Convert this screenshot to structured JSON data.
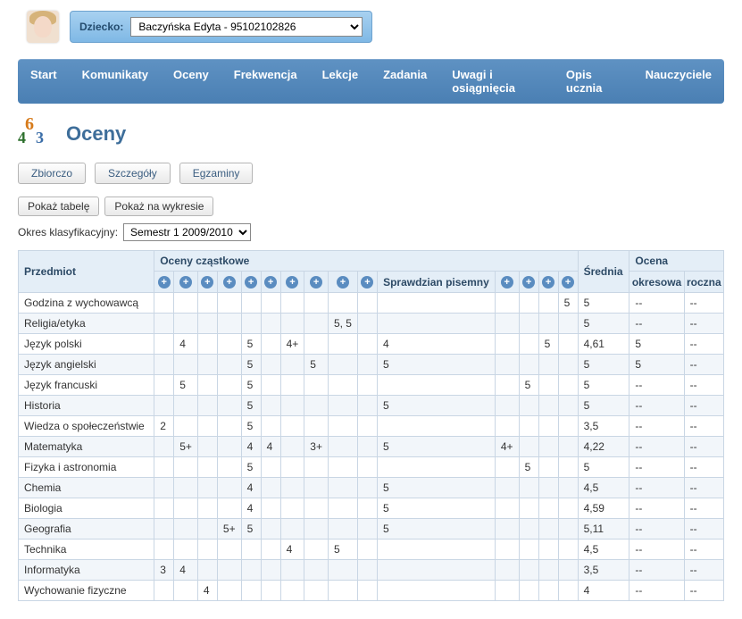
{
  "child_label": "Dziecko:",
  "child_selected": "Baczyńska Edyta - 95102102826",
  "nav": [
    "Start",
    "Komunikaty",
    "Oceny",
    "Frekwencja",
    "Lekcje",
    "Zadania",
    "Uwagi i osiągnięcia",
    "Opis ucznia",
    "Nauczyciele"
  ],
  "page_title": "Oceny",
  "tabs": [
    "Zbiorczo",
    "Szczegóły",
    "Egzaminy"
  ],
  "view_buttons": [
    "Pokaż tabelę",
    "Pokaż na wykresie"
  ],
  "period_label": "Okres klasyfikacyjny:",
  "period_selected": "Semestr 1 2009/2010",
  "headers": {
    "subject": "Przedmiot",
    "partial": "Oceny cząstkowe",
    "written": "Sprawdzian pisemny",
    "avg": "Średnia",
    "final": "Ocena",
    "periodic": "okresowa",
    "yearly": "roczna"
  },
  "rows": [
    {
      "subject": "Godzina z wychowawcą",
      "g": [
        "",
        "",
        "",
        "",
        "",
        "",
        "",
        "",
        "",
        ""
      ],
      "written": "",
      "g2": [
        "",
        "",
        "",
        "5"
      ],
      "avg": "5",
      "per": "--",
      "yr": "--"
    },
    {
      "subject": "Religia/etyka",
      "g": [
        "",
        "",
        "",
        "",
        "",
        "",
        "",
        "",
        "5, 5",
        ""
      ],
      "written": "",
      "g2": [
        "",
        "",
        "",
        ""
      ],
      "avg": "5",
      "per": "--",
      "yr": "--"
    },
    {
      "subject": "Język polski",
      "g": [
        "",
        "4",
        "",
        "",
        "5",
        "",
        "4+",
        "",
        "",
        ""
      ],
      "written": "4",
      "g2": [
        "",
        "",
        "5",
        ""
      ],
      "avg": "4,61",
      "per": "5",
      "yr": "--"
    },
    {
      "subject": "Język angielski",
      "g": [
        "",
        "",
        "",
        "",
        "5",
        "",
        "",
        "5",
        "",
        ""
      ],
      "written": "5",
      "g2": [
        "",
        "",
        "",
        ""
      ],
      "avg": "5",
      "per": "5",
      "yr": "--"
    },
    {
      "subject": "Język francuski",
      "g": [
        "",
        "5",
        "",
        "",
        "5",
        "",
        "",
        "",
        "",
        ""
      ],
      "written": "",
      "g2": [
        "",
        "5",
        "",
        ""
      ],
      "avg": "5",
      "per": "--",
      "yr": "--"
    },
    {
      "subject": "Historia",
      "g": [
        "",
        "",
        "",
        "",
        "5",
        "",
        "",
        "",
        "",
        ""
      ],
      "written": "5",
      "g2": [
        "",
        "",
        "",
        ""
      ],
      "avg": "5",
      "per": "--",
      "yr": "--"
    },
    {
      "subject": "Wiedza o społeczeństwie",
      "g": [
        "2",
        "",
        "",
        "",
        "5",
        "",
        "",
        "",
        "",
        ""
      ],
      "written": "",
      "g2": [
        "",
        "",
        "",
        ""
      ],
      "avg": "3,5",
      "per": "--",
      "yr": "--"
    },
    {
      "subject": "Matematyka",
      "g": [
        "",
        "5+",
        "",
        "",
        "4",
        "4",
        "",
        "3+",
        "",
        ""
      ],
      "written": "5",
      "g2": [
        "4+",
        "",
        "",
        ""
      ],
      "avg": "4,22",
      "per": "--",
      "yr": "--"
    },
    {
      "subject": "Fizyka i astronomia",
      "g": [
        "",
        "",
        "",
        "",
        "5",
        "",
        "",
        "",
        "",
        ""
      ],
      "written": "",
      "g2": [
        "",
        "5",
        "",
        ""
      ],
      "avg": "5",
      "per": "--",
      "yr": "--"
    },
    {
      "subject": "Chemia",
      "g": [
        "",
        "",
        "",
        "",
        "4",
        "",
        "",
        "",
        "",
        ""
      ],
      "written": "5",
      "g2": [
        "",
        "",
        "",
        ""
      ],
      "avg": "4,5",
      "per": "--",
      "yr": "--"
    },
    {
      "subject": "Biologia",
      "g": [
        "",
        "",
        "",
        "",
        "4",
        "",
        "",
        "",
        "",
        ""
      ],
      "written": "5",
      "g2": [
        "",
        "",
        "",
        ""
      ],
      "avg": "4,59",
      "per": "--",
      "yr": "--"
    },
    {
      "subject": "Geografia",
      "g": [
        "",
        "",
        "",
        "5+",
        "5",
        "",
        "",
        "",
        "",
        ""
      ],
      "written": "5",
      "g2": [
        "",
        "",
        "",
        ""
      ],
      "avg": "5,11",
      "per": "--",
      "yr": "--"
    },
    {
      "subject": "Technika",
      "g": [
        "",
        "",
        "",
        "",
        "",
        "",
        "4",
        "",
        "5",
        ""
      ],
      "written": "",
      "g2": [
        "",
        "",
        "",
        ""
      ],
      "avg": "4,5",
      "per": "--",
      "yr": "--"
    },
    {
      "subject": "Informatyka",
      "g": [
        "3",
        "4",
        "",
        "",
        "",
        "",
        "",
        "",
        "",
        ""
      ],
      "written": "",
      "g2": [
        "",
        "",
        "",
        ""
      ],
      "avg": "3,5",
      "per": "--",
      "yr": "--"
    },
    {
      "subject": "Wychowanie fizyczne",
      "g": [
        "",
        "",
        "4",
        "",
        "",
        "",
        "",
        "",
        "",
        ""
      ],
      "written": "",
      "g2": [
        "",
        "",
        "",
        ""
      ],
      "avg": "4",
      "per": "--",
      "yr": "--"
    }
  ]
}
